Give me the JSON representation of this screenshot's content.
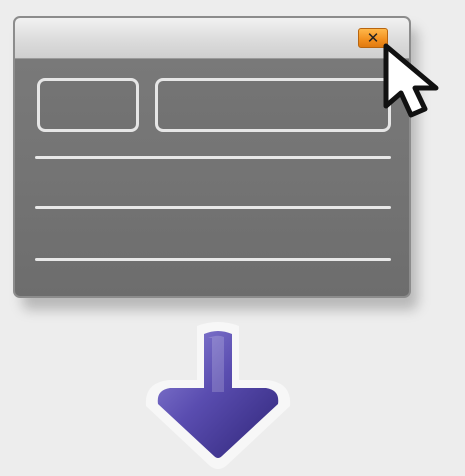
{
  "window": {
    "close_symbol": "✕"
  },
  "icons": {
    "close": "close-icon",
    "cursor": "mouse-pointer-icon",
    "arrow": "arrow-down-icon"
  },
  "colors": {
    "window_body": "#777777",
    "titlebar": "#e2e2e2",
    "close_button": "#f59a25",
    "arrow": "#4b3f9c",
    "background": "#ededed"
  }
}
